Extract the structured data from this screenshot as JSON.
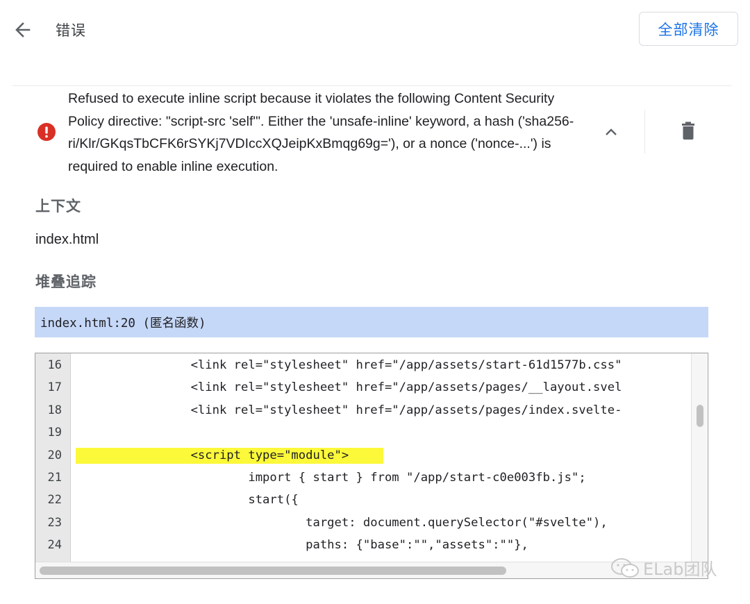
{
  "header": {
    "title": "错误",
    "clear_all_label": "全部清除"
  },
  "error": {
    "message": "Refused to execute inline script because it violates the following Content Security Policy directive: \"script-src 'self'\". Either the 'unsafe-inline' keyword, a hash ('sha256-ri/Klr/GKqsTbCFK6rSYKj7VDIccXQJeipKxBmqg69g='), or a nonce ('nonce-...') is required to enable inline execution.",
    "icon": "error-icon",
    "status_color": "#d93025"
  },
  "context": {
    "heading": "上下文",
    "value": "index.html"
  },
  "stack": {
    "heading": "堆叠追踪",
    "frame": "index.html:20 (匿名函数)"
  },
  "code": {
    "highlight_line": 20,
    "lines": [
      {
        "number": "16",
        "text": "                <link rel=\"stylesheet\" href=\"/app/assets/start-61d1577b.css\""
      },
      {
        "number": "17",
        "text": "                <link rel=\"stylesheet\" href=\"/app/assets/pages/__layout.svel"
      },
      {
        "number": "18",
        "text": "                <link rel=\"stylesheet\" href=\"/app/assets/pages/index.svelte-"
      },
      {
        "number": "19",
        "text": ""
      },
      {
        "number": "20",
        "text": "                <script type=\"module\">"
      },
      {
        "number": "21",
        "text": "                        import { start } from \"/app/start-c0e003fb.js\";"
      },
      {
        "number": "22",
        "text": "                        start({"
      },
      {
        "number": "23",
        "text": "                                target: document.querySelector(\"#svelte\"),"
      },
      {
        "number": "24",
        "text": "                                paths: {\"base\":\"\",\"assets\":\"\"},"
      }
    ]
  },
  "watermark": {
    "text": "ELab团队"
  },
  "colors": {
    "accent": "#1a73e8",
    "stack_frame_bg": "#c6d8f8",
    "highlight": "#fcf83a"
  }
}
